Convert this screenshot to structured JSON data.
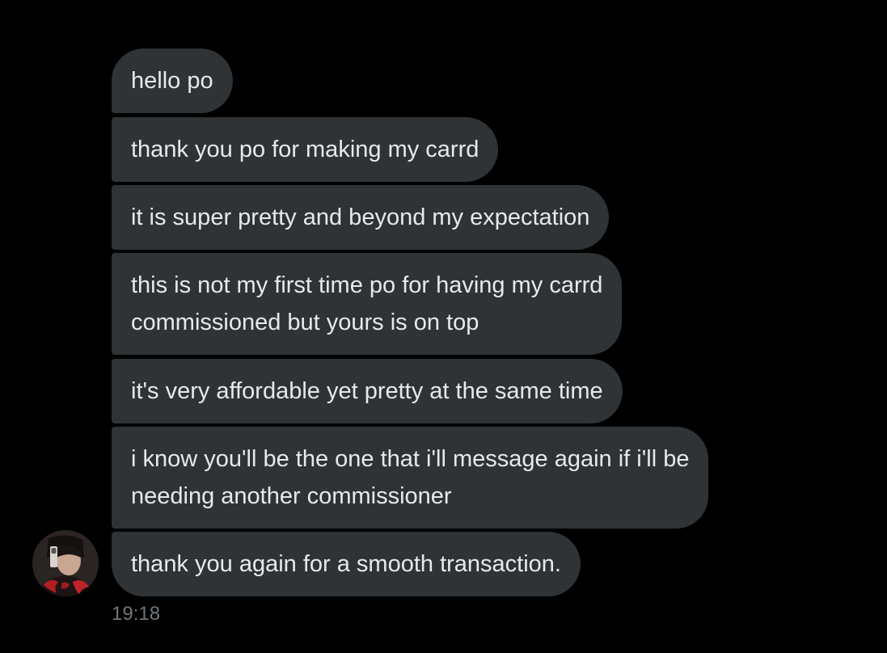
{
  "conversation": {
    "messages": [
      {
        "text": "hello po"
      },
      {
        "text": "thank you po for making my carrd"
      },
      {
        "text": "it is super pretty and beyond my expectation"
      },
      {
        "text": "this is not my first time po for having my carrd\ncommissioned but yours is on top"
      },
      {
        "text": "it's very affordable yet pretty at the same time"
      },
      {
        "text": "i know you'll be the one that i'll message again if i'll be\nneeding another commissioner"
      },
      {
        "text": "thank you again for a smooth transaction."
      }
    ],
    "timestamp": "19:18",
    "avatar_icon": "user-avatar-icon"
  },
  "colors": {
    "background": "#000000",
    "bubble": "#2f3336",
    "text": "#e7e9ea",
    "timestamp": "#71767b"
  }
}
